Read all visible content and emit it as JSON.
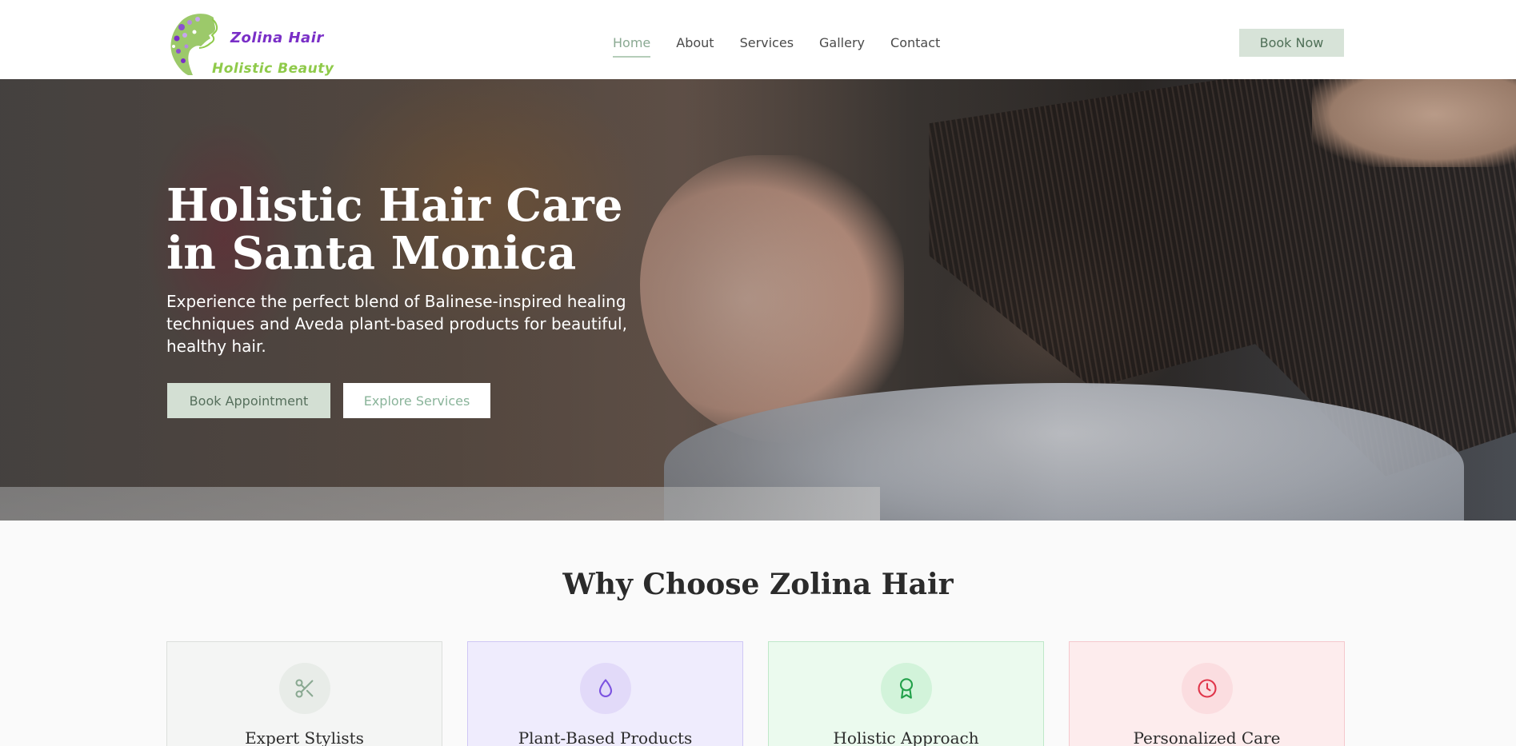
{
  "brand": {
    "line1": "Zolina Hair",
    "line2": "Holistic Beauty"
  },
  "nav": {
    "items": [
      {
        "label": "Home",
        "active": true
      },
      {
        "label": "About"
      },
      {
        "label": "Services"
      },
      {
        "label": "Gallery"
      },
      {
        "label": "Contact"
      }
    ],
    "cta": "Book Now"
  },
  "hero": {
    "title": "Holistic Hair Care in Santa Monica",
    "subtitle": "Experience the perfect blend of Balinese-inspired healing techniques and Aveda plant-based products for beautiful, healthy hair.",
    "primary_button": "Book Appointment",
    "secondary_button": "Explore Services"
  },
  "why": {
    "title": "Why Choose Zolina Hair",
    "cards": [
      {
        "title": "Expert Stylists",
        "icon": "scissors-icon",
        "color": "#8aa992"
      },
      {
        "title": "Plant-Based Products",
        "icon": "droplet-icon",
        "color": "#7b52e0"
      },
      {
        "title": "Holistic Approach",
        "icon": "award-icon",
        "color": "#22a04a"
      },
      {
        "title": "Personalized Care",
        "icon": "clock-icon",
        "color": "#e0354a"
      }
    ]
  },
  "colors": {
    "brand_purple": "#7a2fc7",
    "brand_green": "#8fca4a",
    "sage": "#d7e3d8"
  }
}
